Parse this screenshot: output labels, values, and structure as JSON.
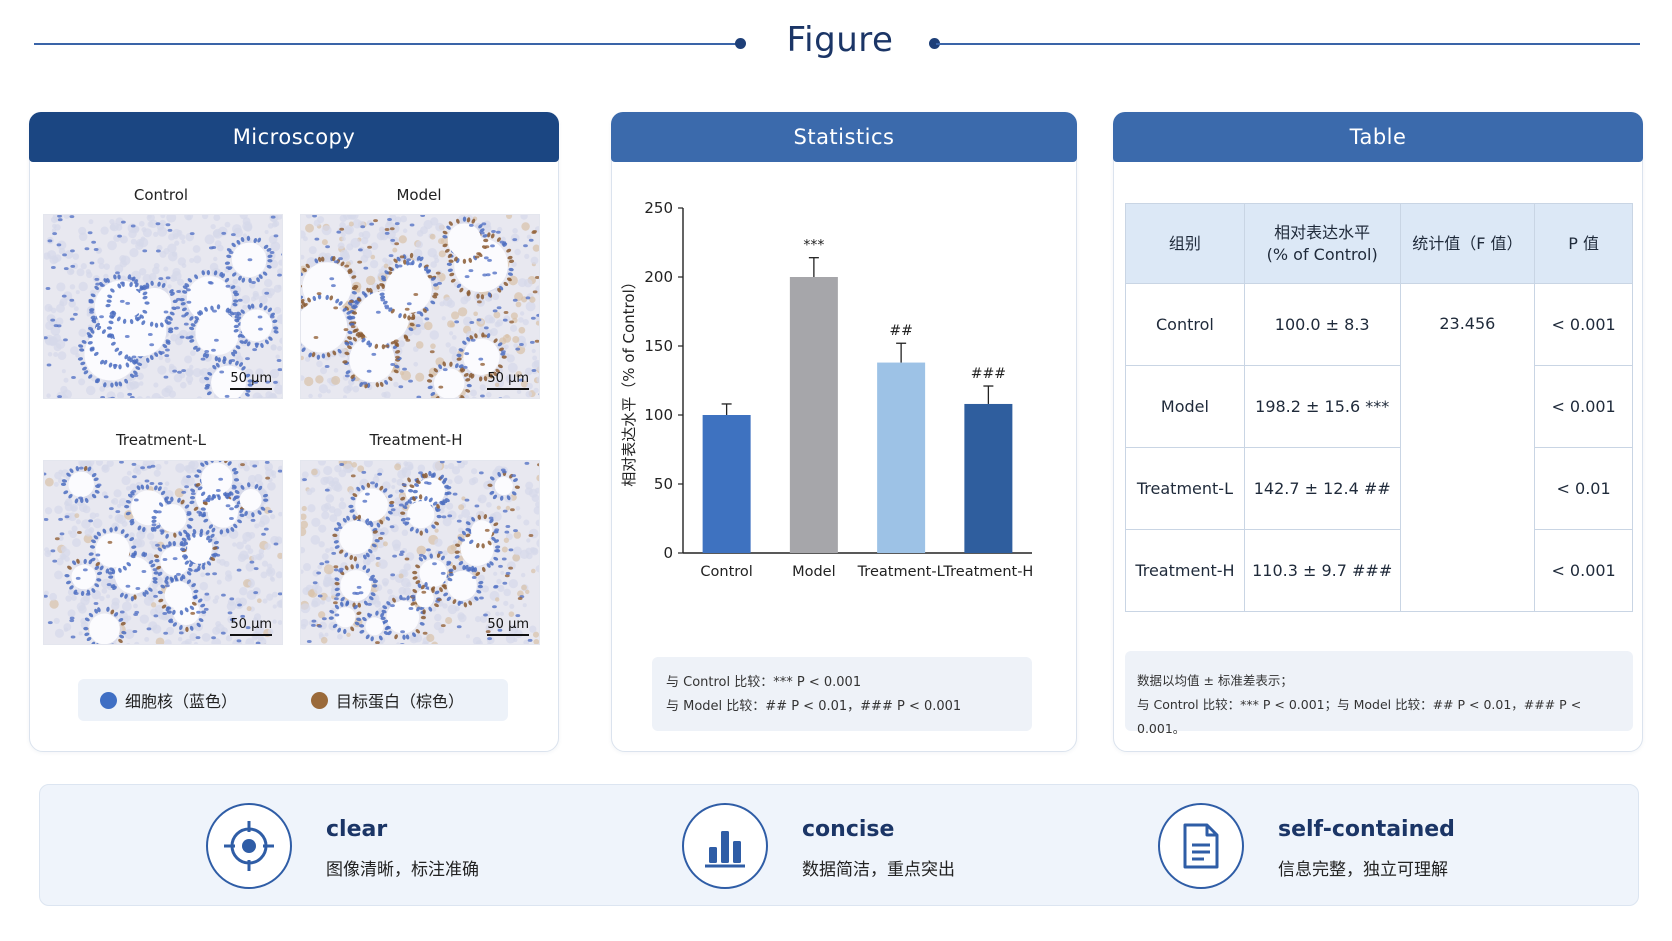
{
  "header": {
    "title": "Figure"
  },
  "microscopy": {
    "title": "Microscopy",
    "images": [
      {
        "label": "Control",
        "scale": "50 μm",
        "stain": "none"
      },
      {
        "label": "Model",
        "scale": "50 μm",
        "stain": "strong"
      },
      {
        "label": "Treatment-L",
        "scale": "50 μm",
        "stain": "light"
      },
      {
        "label": "Treatment-H",
        "scale": "50 μm",
        "stain": "medium"
      }
    ],
    "legend": [
      {
        "label": "细胞核（蓝色）",
        "color": "#3f6fc4"
      },
      {
        "label": "目标蛋白（棕色）",
        "color": "#9a6a3a"
      }
    ]
  },
  "statistics": {
    "title": "Statistics",
    "notes": [
      "与 Control 比较：*** P < 0.001",
      "与 Model 比较：## P < 0.01，### P < 0.001"
    ]
  },
  "chart_data": {
    "type": "bar",
    "categories": [
      "Control",
      "Model",
      "Treatment-L",
      "Treatment-H"
    ],
    "values": [
      100,
      200,
      138,
      108
    ],
    "errors": [
      8,
      14,
      14,
      13
    ],
    "significance": [
      "",
      "***",
      "##",
      "###"
    ],
    "colors": [
      "#3e72c0",
      "#a6a6aa",
      "#9dc2e6",
      "#2f5e9e"
    ],
    "ylabel": "相对表达水平（% of Control）",
    "ylim": [
      0,
      250
    ],
    "yticks": [
      0,
      50,
      100,
      150,
      200,
      250
    ],
    "grid": false
  },
  "table": {
    "title": "Table",
    "headers": [
      "组别",
      "相对表达水平",
      "(% of Control)",
      "统计值（F 值）",
      "P 值"
    ],
    "rows": [
      {
        "group": "Control",
        "value": "100.0 ± 8.3",
        "p": "< 0.001"
      },
      {
        "group": "Model",
        "value": "198.2 ± 15.6 ***",
        "p": "< 0.001"
      },
      {
        "group": "Treatment-L",
        "value": "142.7 ± 12.4 ##",
        "p": "< 0.01"
      },
      {
        "group": "Treatment-H",
        "value": "110.3 ± 9.7 ###",
        "p": "< 0.001"
      }
    ],
    "f_value": "23.456",
    "notes": [
      "数据以均值 ± 标准差表示；",
      "与 Control 比较：*** P < 0.001；与 Model 比较：## P < 0.01，### P < 0.001。"
    ]
  },
  "features": [
    {
      "title": "clear",
      "subtitle": "图像清晰，标注准确",
      "icon": "target-icon"
    },
    {
      "title": "concise",
      "subtitle": "数据简洁，重点突出",
      "icon": "bar-chart-icon"
    },
    {
      "title": "self-contained",
      "subtitle": "信息完整，独立可理解",
      "icon": "document-icon"
    }
  ]
}
